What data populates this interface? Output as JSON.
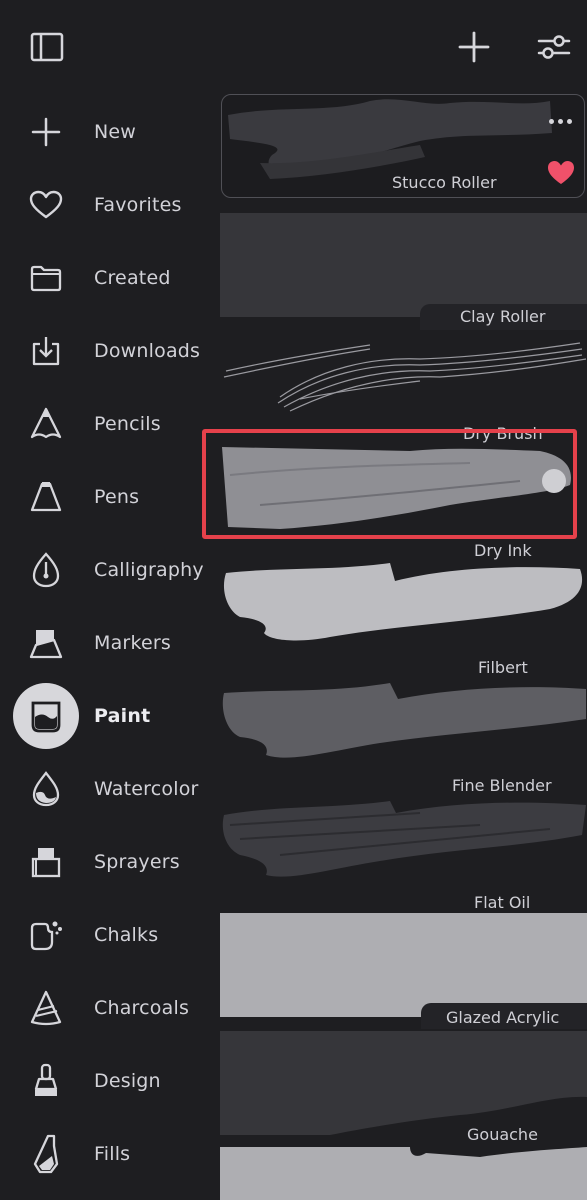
{
  "toolbar": {
    "sidebar_icon": "sidebar-toggle-icon",
    "add_icon": "plus-icon",
    "settings_icon": "sliders-icon"
  },
  "sidebar": {
    "items": [
      {
        "label": "New",
        "icon": "plus-icon",
        "active": false
      },
      {
        "label": "Favorites",
        "icon": "heart-icon",
        "active": false
      },
      {
        "label": "Created",
        "icon": "folder-icon",
        "active": false
      },
      {
        "label": "Downloads",
        "icon": "download-icon",
        "active": false
      },
      {
        "label": "Pencils",
        "icon": "pencil-tip-icon",
        "active": false
      },
      {
        "label": "Pens",
        "icon": "pen-tip-icon",
        "active": false
      },
      {
        "label": "Calligraphy",
        "icon": "calligraphy-nib-icon",
        "active": false
      },
      {
        "label": "Markers",
        "icon": "marker-icon",
        "active": false
      },
      {
        "label": "Paint",
        "icon": "paint-cup-icon",
        "active": true
      },
      {
        "label": "Watercolor",
        "icon": "water-drop-icon",
        "active": false
      },
      {
        "label": "Sprayers",
        "icon": "spray-can-icon",
        "active": false
      },
      {
        "label": "Chalks",
        "icon": "chalk-icon",
        "active": false
      },
      {
        "label": "Charcoals",
        "icon": "charcoal-icon",
        "active": false
      },
      {
        "label": "Design",
        "icon": "design-nib-icon",
        "active": false
      },
      {
        "label": "Fills",
        "icon": "fill-nib-icon",
        "active": false
      }
    ]
  },
  "brushes": [
    {
      "name": "Stucco Roller",
      "favorite": true,
      "selected": true
    },
    {
      "name": "Clay Roller"
    },
    {
      "name": "Dry Brush"
    },
    {
      "name": "Dry Ink"
    },
    {
      "name": "Filbert"
    },
    {
      "name": "Fine Blender"
    },
    {
      "name": "Flat Oil"
    },
    {
      "name": "Glazed Acrylic"
    },
    {
      "name": "Gouache"
    }
  ],
  "colors": {
    "background": "#1e1e21",
    "highlight": "#e5414b",
    "favorite": "#f0516a",
    "active_pill": "#d7d7db"
  }
}
